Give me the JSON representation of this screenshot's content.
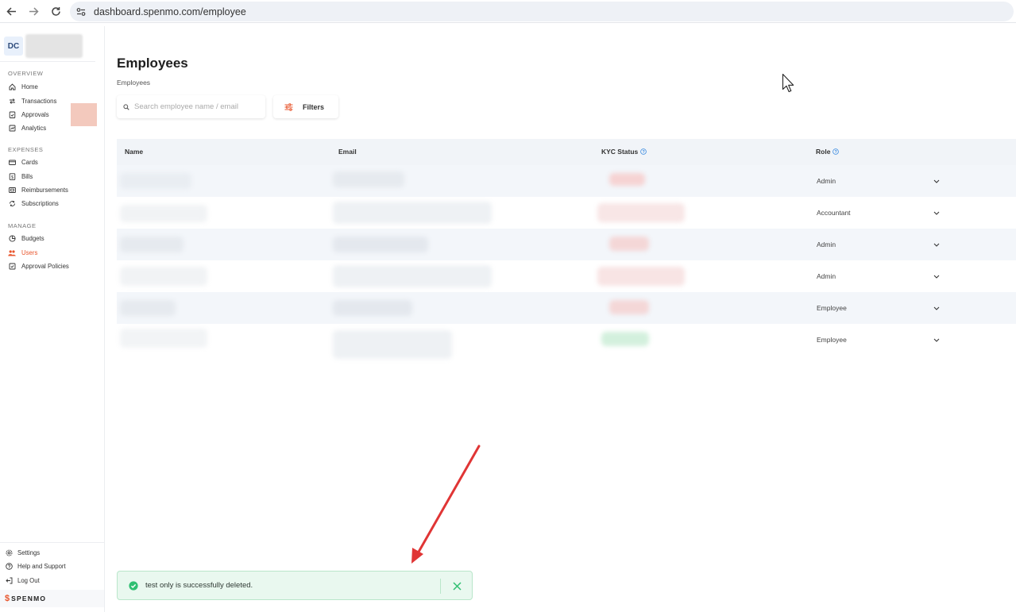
{
  "browser": {
    "url": "dashboard.spenmo.com/employee"
  },
  "sidebar": {
    "org_initials": "DC",
    "sections": [
      {
        "label": "OVERVIEW",
        "items": [
          {
            "label": "Home",
            "icon": "home-icon"
          },
          {
            "label": "Transactions",
            "icon": "transfer-icon"
          },
          {
            "label": "Approvals",
            "icon": "clipboard-check-icon"
          },
          {
            "label": "Analytics",
            "icon": "chart-icon"
          }
        ]
      },
      {
        "label": "EXPENSES",
        "items": [
          {
            "label": "Cards",
            "icon": "card-icon"
          },
          {
            "label": "Bills",
            "icon": "bill-icon"
          },
          {
            "label": "Reimbursements",
            "icon": "reimburse-icon"
          },
          {
            "label": "Subscriptions",
            "icon": "refresh-icon"
          }
        ]
      },
      {
        "label": "MANAGE",
        "items": [
          {
            "label": "Budgets",
            "icon": "pie-icon"
          },
          {
            "label": "Users",
            "icon": "users-icon",
            "active": true
          },
          {
            "label": "Approval Policies",
            "icon": "policy-icon"
          }
        ]
      }
    ],
    "bottom": [
      {
        "label": "Settings",
        "icon": "gear-icon"
      },
      {
        "label": "Help and Support",
        "icon": "help-icon"
      },
      {
        "label": "Log Out",
        "icon": "logout-icon"
      }
    ],
    "brand": "SPENMO",
    "accent": "#e8552c"
  },
  "main": {
    "title": "Employees",
    "breadcrumb": "Employees",
    "search_placeholder": "Search employee name / email",
    "filters_label": "Filters",
    "table": {
      "columns": [
        "Name",
        "Email",
        "KYC Status",
        "Role"
      ],
      "rows": [
        {
          "role": "Admin",
          "kyc": "red"
        },
        {
          "role": "Accountant",
          "kyc": "red"
        },
        {
          "role": "Admin",
          "kyc": "red"
        },
        {
          "role": "Admin",
          "kyc": "red"
        },
        {
          "role": "Employee",
          "kyc": "red"
        },
        {
          "role": "Employee",
          "kyc": "green"
        }
      ]
    }
  },
  "toast": {
    "message": "test only is successfully deleted.",
    "color": "#2fbf71"
  }
}
